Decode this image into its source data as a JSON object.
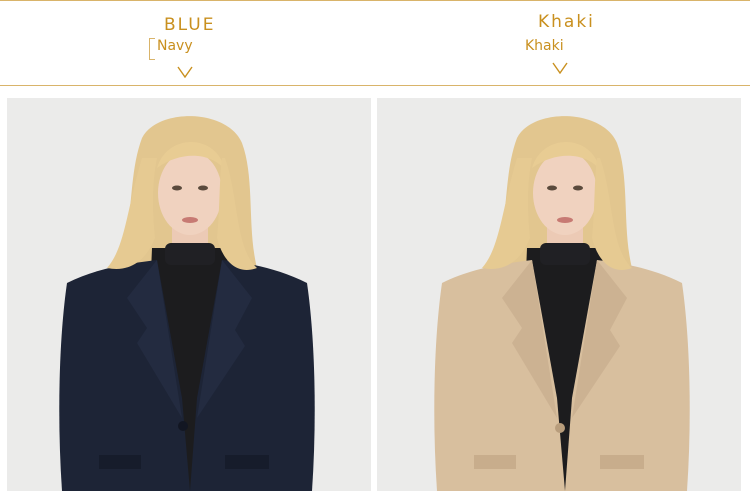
{
  "variants": [
    {
      "color_name": "BLUE",
      "sub_name": "Navy",
      "chevron_icon": "chevron-down-icon",
      "coat_color": "#1d2436"
    },
    {
      "color_name": "Khaki",
      "sub_name": "Khaki",
      "chevron_icon": "chevron-down-icon",
      "coat_color": "#d8bf9e"
    }
  ],
  "colors": {
    "accent": "#c9901f",
    "rule": "#d9b46a",
    "background": "#ebebea",
    "turtleneck": "#1c1c1e",
    "hair": "#e2c68f",
    "skin": "#f0d2bf"
  }
}
